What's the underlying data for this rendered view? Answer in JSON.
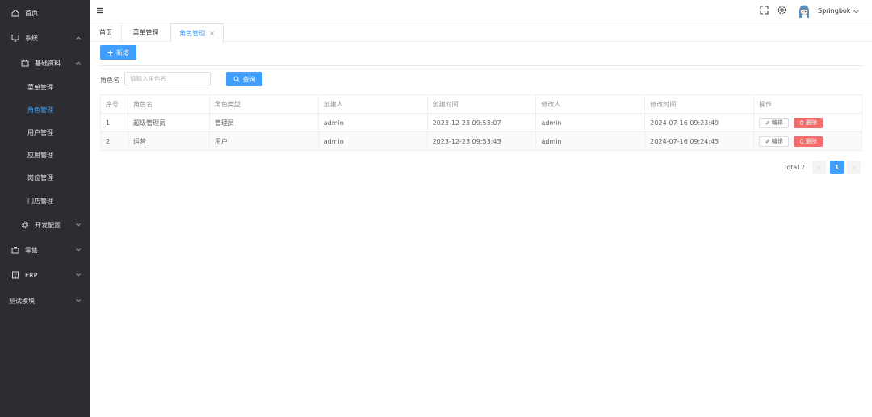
{
  "sidebar": {
    "home": "首页",
    "system": "系统",
    "basic_data": "基础资料",
    "menu_mgmt": "菜单管理",
    "role_mgmt": "角色管理",
    "user_mgmt": "用户管理",
    "app_mgmt": "应用管理",
    "post_mgmt": "岗位管理",
    "store_mgmt": "门店管理",
    "dev_config": "开发配置",
    "retail": "零售",
    "erp": "ERP",
    "test_module": "测试模块"
  },
  "header": {
    "username": "Springbok"
  },
  "tabs": [
    {
      "label": "首页"
    },
    {
      "label": "菜单管理"
    },
    {
      "label": "角色管理",
      "close": "×"
    }
  ],
  "toolbar": {
    "add_label": "新增"
  },
  "search": {
    "label": "角色名",
    "placeholder": "请输入角色名",
    "button_label": "查询"
  },
  "table": {
    "headers": [
      "序号",
      "角色名",
      "角色类型",
      "创建人",
      "创建时间",
      "修改人",
      "修改时间",
      "操作"
    ],
    "rows": [
      [
        "1",
        "超级管理员",
        "管理员",
        "admin",
        "2023-12-23 09:53:07",
        "admin",
        "2024-07-16 09:23:49"
      ],
      [
        "2",
        "运营",
        "用户",
        "admin",
        "2023-12-23 09:53:43",
        "admin",
        "2024-07-16 09:24:43"
      ]
    ],
    "edit_label": "编辑",
    "delete_label": "删除"
  },
  "pagination": {
    "total": "Total 2",
    "current": "1",
    "prev": "‹",
    "next": "›"
  },
  "colors": {
    "primary": "#409eff",
    "danger": "#f56c6c",
    "sidebar_bg": "#2b2d30"
  }
}
